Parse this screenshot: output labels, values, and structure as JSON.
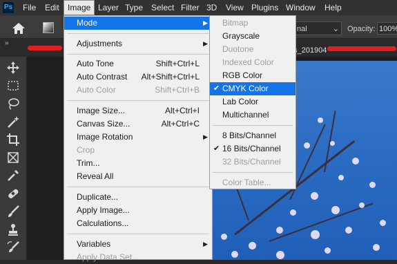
{
  "app_logo": "Ps",
  "menubar": {
    "items": [
      "File",
      "Edit",
      "Image",
      "Layer",
      "Type",
      "Select",
      "Filter",
      "3D",
      "View",
      "Plugins",
      "Window",
      "Help"
    ]
  },
  "options_bar": {
    "blend_mode": "nal",
    "opacity_label": "Opacity:",
    "opacity_value": "100%"
  },
  "tab": {
    "title_fragment": "s_201904"
  },
  "image_menu": {
    "mode": "Mode",
    "adjustments": "Adjustments",
    "auto_tone": "Auto Tone",
    "auto_tone_sc": "Shift+Ctrl+L",
    "auto_contrast": "Auto Contrast",
    "auto_contrast_sc": "Alt+Shift+Ctrl+L",
    "auto_color": "Auto Color",
    "auto_color_sc": "Shift+Ctrl+B",
    "image_size": "Image Size...",
    "image_size_sc": "Alt+Ctrl+I",
    "canvas_size": "Canvas Size...",
    "canvas_size_sc": "Alt+Ctrl+C",
    "image_rotation": "Image Rotation",
    "crop": "Crop",
    "trim": "Trim...",
    "reveal_all": "Reveal All",
    "duplicate": "Duplicate...",
    "apply_image": "Apply Image...",
    "calculations": "Calculations...",
    "variables": "Variables",
    "apply_data_set": "Apply Data Set..."
  },
  "mode_submenu": {
    "bitmap": "Bitmap",
    "grayscale": "Grayscale",
    "duotone": "Duotone",
    "indexed_color": "Indexed Color",
    "rgb_color": "RGB Color",
    "cmyk_color": "CMYK Color",
    "lab_color": "Lab Color",
    "multichannel": "Multichannel",
    "bits8": "8 Bits/Channel",
    "bits16": "16 Bits/Channel",
    "bits32": "32 Bits/Channel",
    "color_table": "Color Table..."
  },
  "colors": {
    "highlight": "#1473e6",
    "menu_bg": "#f0f0f0",
    "app_bg": "#282828"
  }
}
